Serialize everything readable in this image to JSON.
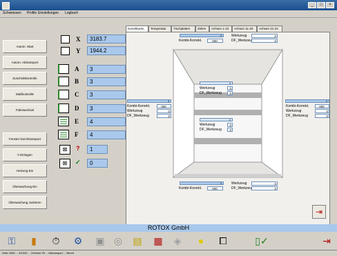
{
  "menu": [
    "Schweissen",
    "Profile",
    "Einstellungen",
    "Logbuch"
  ],
  "sidebar": {
    "buttons": [
      "Autom. Start",
      "Autom. Abtransport",
      "Zuschnittkontrolle",
      "Maßkontrolle",
      "Fülerwechsel",
      "Fenster Durchtransport",
      "h Einlegen",
      "Heizung Ein",
      "Überwachung Ein",
      "Überwachung Justieren"
    ]
  },
  "axes": [
    {
      "label": "X",
      "value": "3183.7"
    },
    {
      "label": "Y",
      "value": "1944.2"
    },
    {
      "label": "A",
      "value": "3"
    },
    {
      "label": "B",
      "value": "3"
    },
    {
      "label": "C",
      "value": "3"
    },
    {
      "label": "D",
      "value": "3"
    },
    {
      "label": "E",
      "value": "4"
    },
    {
      "label": "F",
      "value": "4"
    }
  ],
  "counters": [
    {
      "symbol": "?",
      "value": "1"
    },
    {
      "symbol": "✓",
      "value": "0"
    }
  ],
  "tabs": [
    "Korrekturen",
    "Temperatur",
    "Tischplatten",
    "Zeilen",
    "Achsen 1-10",
    "Achsen 11-20",
    "Achsen 21-24"
  ],
  "corrections": {
    "top": {
      "bar": "3",
      "werkzeug_label": "Werkzeug",
      "werkzeug_val": "0",
      "kombi_label": "Kombi-Korrekt.",
      "kombi_val": "000",
      "df_label": "DF_Werkzeug",
      "df_val": "0"
    },
    "bottom": {
      "bar": "3",
      "werkzeug_label": "Werkzeug",
      "werkzeug_val": "0",
      "kombi_label": "Kombi-Korrekt.",
      "kombi_val": "000",
      "df_label": "DF_Werkzeug",
      "df_val": "0"
    },
    "left": {
      "bar": "3",
      "kombi_label": "Kombi-Korrekt.",
      "kombi_val": "000",
      "werkzeug_label": "Werkzeug",
      "werkzeug_val": "0",
      "df_label": "DF_Werkzeug",
      "df_val": "0"
    },
    "right": {
      "bar": "3",
      "kombi_label": "Kombi-Korrekt.",
      "kombi_val": "000",
      "werkzeug_label": "Werkzeug",
      "werkzeug_val": "0",
      "df_label": "DF_Werkzeug",
      "df_val": "0"
    },
    "center_top": {
      "bar": "4",
      "werkzeug_label": "Werkzeug",
      "werkzeug_val": "0",
      "df_label": "DF_Werkzeug",
      "df_val": "0"
    },
    "center_bottom": {
      "bar": "4",
      "werkzeug_label": "Werkzeug",
      "werkzeug_val": "0",
      "df_label": "DF_Werkzeug",
      "df_val": "0"
    }
  },
  "footer_title": "ROTOX GmbH",
  "status": "Zeile 1060 ... 6/1049 ... Zeichen 99 ... Abtransport ... Bereit"
}
